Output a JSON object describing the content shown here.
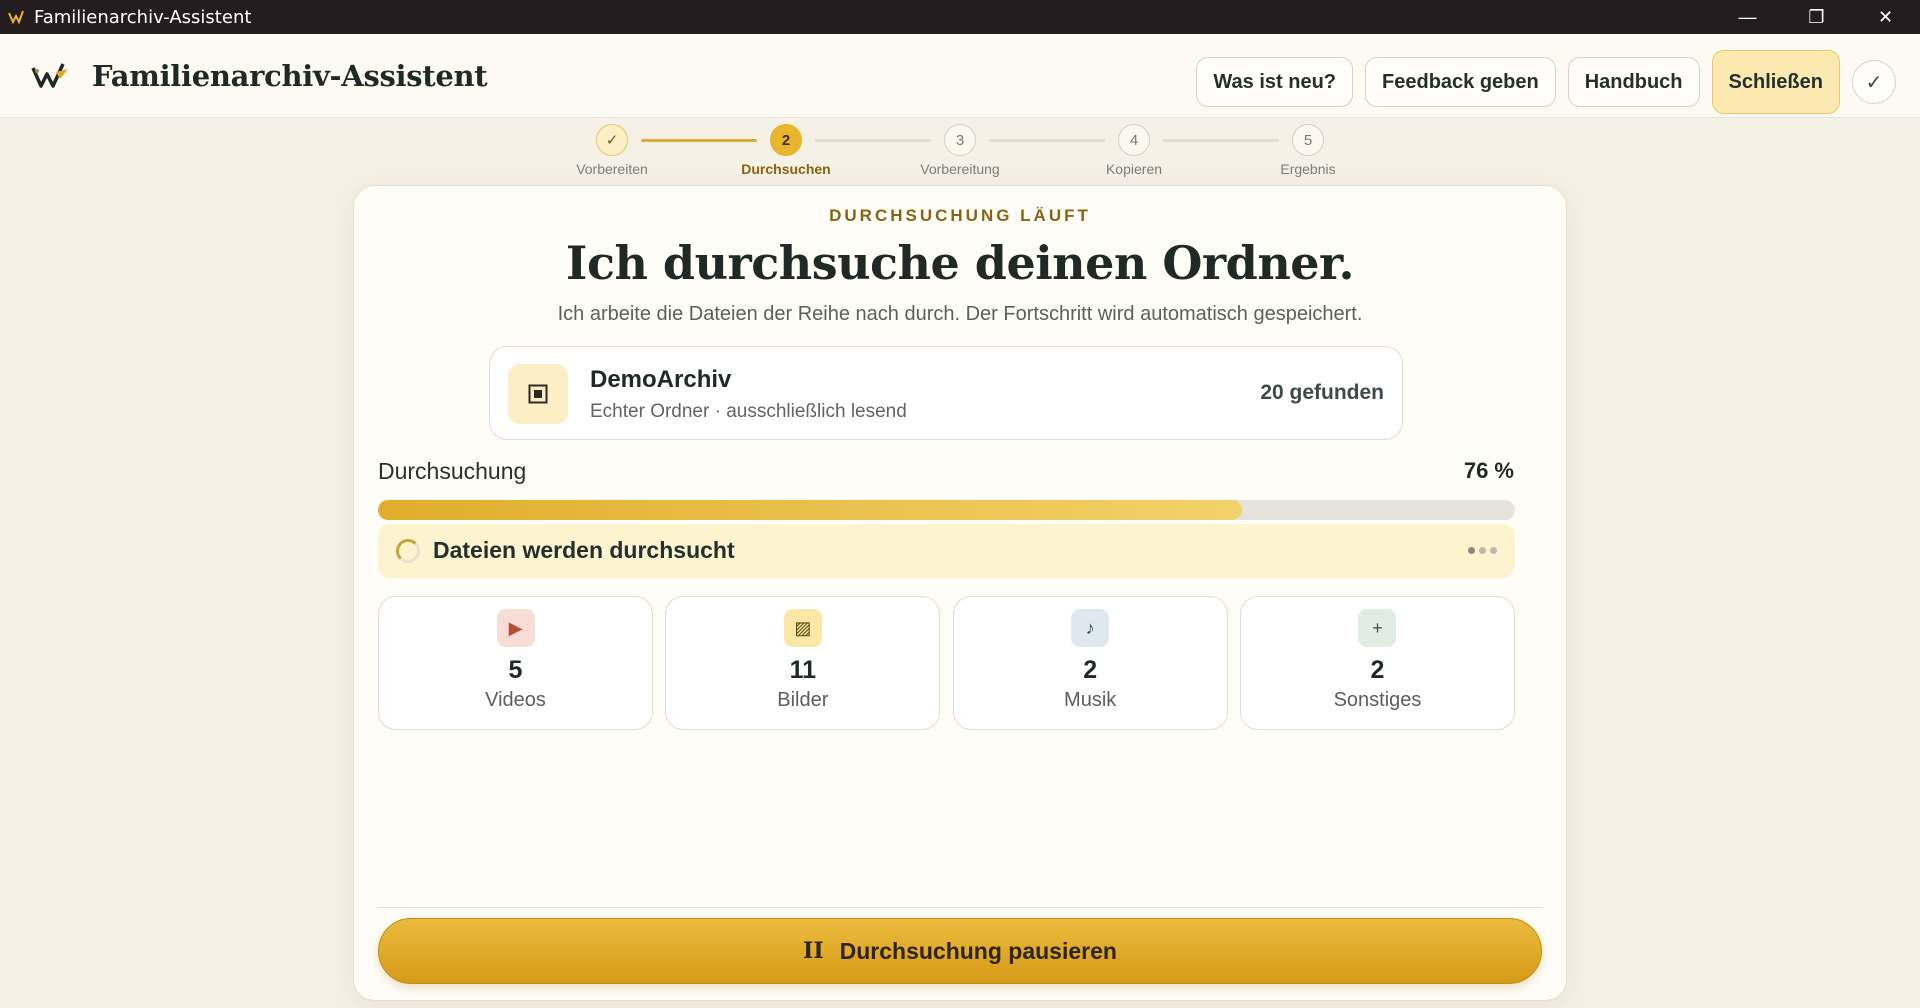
{
  "window": {
    "title": "Familienarchiv-Assistent",
    "controls": {
      "minimize": "—",
      "restore": "❐",
      "close": "✕"
    }
  },
  "header": {
    "brand": "Familienarchiv-Assistent",
    "buttons": {
      "whats_new": "Was ist neu?",
      "feedback": "Feedback geben",
      "manual": "Handbuch",
      "close": "Schließen",
      "check": "✓"
    }
  },
  "stepper": {
    "steps": [
      {
        "number": "✓",
        "label": "Vorbereiten",
        "state": "done"
      },
      {
        "number": "2",
        "label": "Durchsuchen",
        "state": "active"
      },
      {
        "number": "3",
        "label": "Vorbereitung",
        "state": "pending"
      },
      {
        "number": "4",
        "label": "Kopieren",
        "state": "pending"
      },
      {
        "number": "5",
        "label": "Ergebnis",
        "state": "pending"
      }
    ]
  },
  "main": {
    "eyebrow": "DURCHSUCHUNG LÄUFT",
    "headline": "Ich durchsuche deinen Ordner.",
    "subline": "Ich arbeite die Dateien der Reihe nach durch. Der Fortschritt wird automatisch gespeichert.",
    "source": {
      "name": "DemoArchiv",
      "meta": "Echter Ordner · ausschließlich lesend",
      "found": "20 gefunden"
    },
    "progress": {
      "label": "Durchsuchung",
      "percent_text": "76 %",
      "value": 0.76
    },
    "status": {
      "text": "Dateien werden durchsucht"
    },
    "tiles": [
      {
        "icon": "play-icon",
        "glyph": "▶",
        "count": "5",
        "label": "Videos",
        "color": "#f7ddd6",
        "fg": "#b4503a"
      },
      {
        "icon": "image-icon",
        "glyph": "▨",
        "count": "11",
        "label": "Bilder",
        "color": "#fbe7a6",
        "fg": "#5a4610"
      },
      {
        "icon": "music-note-icon",
        "glyph": "♪",
        "count": "2",
        "label": "Musik",
        "color": "#dde9ef",
        "fg": "#2e4a56"
      },
      {
        "icon": "plus-icon",
        "glyph": "+",
        "count": "2",
        "label": "Sonstiges",
        "color": "#e0ece4",
        "fg": "#3a5a46"
      }
    ],
    "pause_button": {
      "icon": "II",
      "label": "Durchsuchung pausieren"
    }
  },
  "colors": {
    "accent": "#e9b52d",
    "titlebar": "#231d1f",
    "background": "#f6f1e6"
  }
}
